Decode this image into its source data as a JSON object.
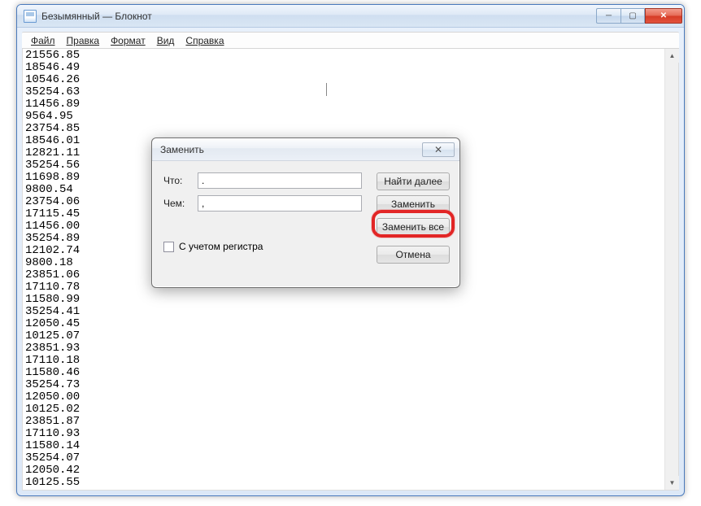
{
  "window": {
    "title": "Безымянный — Блокнот"
  },
  "menu": {
    "file": "Файл",
    "edit": "Правка",
    "format": "Формат",
    "view": "Вид",
    "help": "Справка"
  },
  "editor": {
    "content": "21556.85\n18546.49\n10546.26\n35254.63\n11456.89\n9564.95\n23754.85\n18546.01\n12821.11\n35254.56\n11698.89\n9800.54\n23754.06\n17115.45\n11456.00\n35254.89\n12102.74\n9800.18\n23851.06\n17110.78\n11580.99\n35254.41\n12050.45\n10125.07\n23851.93\n17110.18\n11580.46\n35254.73\n12050.00\n10125.02\n23851.87\n17110.93\n11580.14\n35254.07\n12050.42\n10125.55"
  },
  "dialog": {
    "title": "Заменить",
    "close_glyph": "✕",
    "what_label": "Что:",
    "with_label": "Чем:",
    "what_value": ".",
    "with_value": ",",
    "find_next": "Найти далее",
    "replace": "Заменить",
    "replace_all": "Заменить все",
    "cancel": "Отмена",
    "match_case": "С учетом регистра"
  },
  "win_buttons": {
    "min": "─",
    "max": "▢",
    "close": "✕"
  },
  "scroll": {
    "up": "▲",
    "down": "▼"
  }
}
